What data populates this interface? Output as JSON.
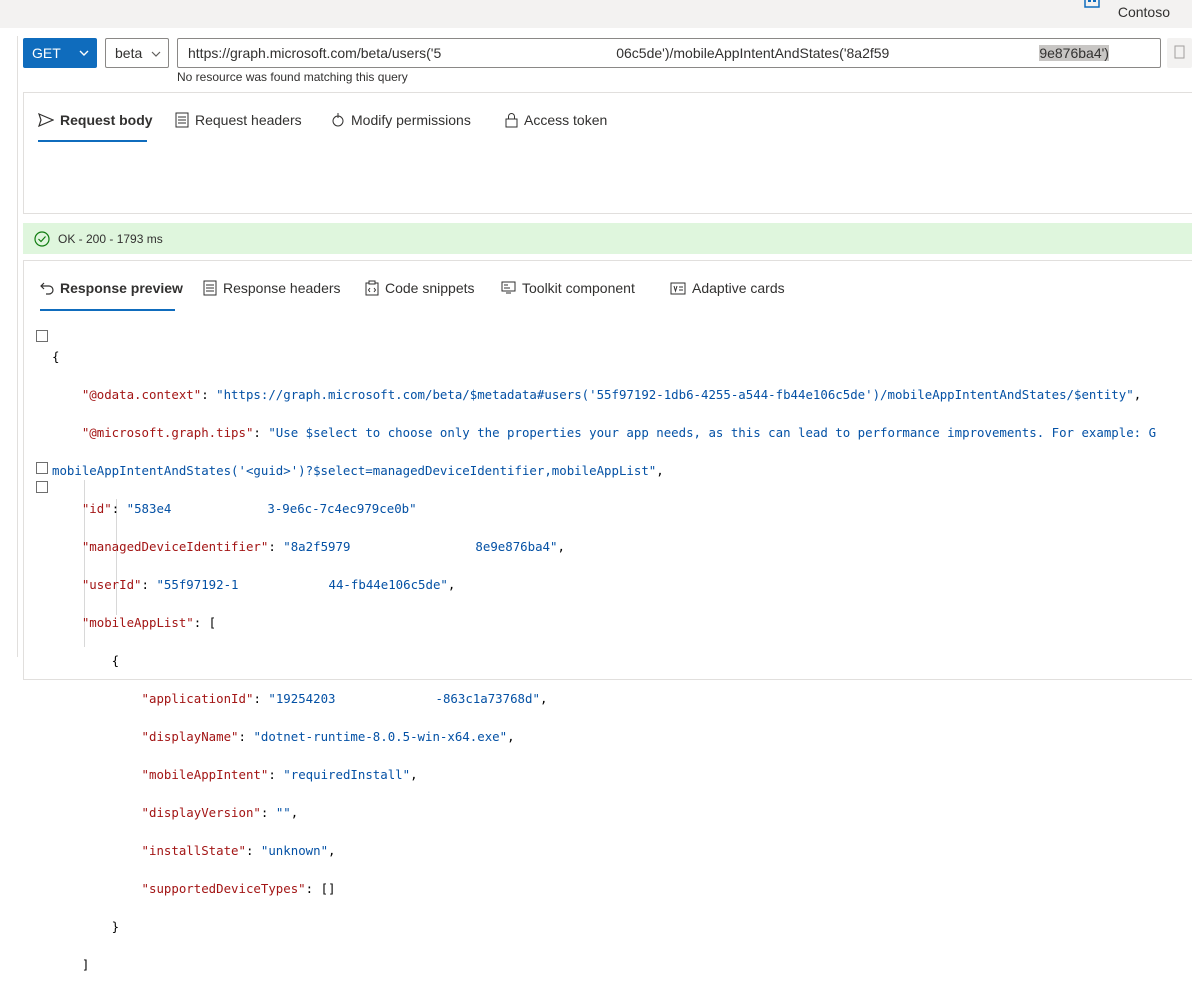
{
  "header": {
    "tenant": "Contoso"
  },
  "query": {
    "method": "GET",
    "version": "beta",
    "url_part1": "https://graph.microsoft.com/beta/users('5",
    "url_part2": "06c5de')/mobileAppIntentAndStates('8a2f59",
    "url_part3": "9e876ba4')",
    "hint": "No resource was found matching this query"
  },
  "request_tabs": [
    {
      "label": "Request body",
      "icon": "send-icon"
    },
    {
      "label": "Request headers",
      "icon": "headers-icon"
    },
    {
      "label": "Modify permissions",
      "icon": "permissions-icon"
    },
    {
      "label": "Access token",
      "icon": "lock-icon"
    }
  ],
  "status": {
    "text": "OK - 200 - 1793 ms",
    "color": "#dff6dd",
    "icon": "check-circle-icon"
  },
  "response_tabs": [
    {
      "label": "Response preview",
      "icon": "undo-icon"
    },
    {
      "label": "Response headers",
      "icon": "headers-icon"
    },
    {
      "label": "Code snippets",
      "icon": "clipboard-icon"
    },
    {
      "label": "Toolkit component",
      "icon": "component-icon"
    },
    {
      "label": "Adaptive cards",
      "icon": "card-icon"
    }
  ],
  "response": {
    "odata_context_key": "\"@odata.context\"",
    "odata_context_val": "\"https://graph.microsoft.com/beta/$metadata#users('55f97192-1db6-4255-a544-fb44e106c5de')/mobileAppIntentAndStates/$entity\"",
    "tips_key": "\"@microsoft.graph.tips\"",
    "tips_val": "\"Use $select to choose only the properties your app needs, as this can lead to performance improvements. For example: G",
    "tips_val_cont": "mobileAppIntentAndStates('<guid>')?$select=managedDeviceIdentifier,mobileAppList\"",
    "id_key": "\"id\"",
    "id_val_a": "\"583e4",
    "id_val_b": "3-9e6c-7c4ec979ce0b\"",
    "mdi_key": "\"managedDeviceIdentifier\"",
    "mdi_val_a": "\"8a2f5979",
    "mdi_val_b": "8e9e876ba4\"",
    "user_key": "\"userId\"",
    "user_val_a": "\"55f97192-1",
    "user_val_b": "44-fb44e106c5de\"",
    "list_key": "\"mobileAppList\"",
    "app": {
      "applicationId_key": "\"applicationId\"",
      "applicationId_val_a": "\"19254203",
      "applicationId_val_b": "-863c1a73768d\"",
      "displayName_key": "\"displayName\"",
      "displayName_val": "\"dotnet-runtime-8.0.5-win-x64.exe\"",
      "intent_key": "\"mobileAppIntent\"",
      "intent_val": "\"requiredInstall\"",
      "version_key": "\"displayVersion\"",
      "version_val": "\"\"",
      "state_key": "\"installState\"",
      "state_val": "\"unknown\"",
      "types_key": "\"supportedDeviceTypes\"",
      "types_val": "[]"
    }
  },
  "colors": {
    "accent": "#0f6cbd",
    "json_key": "#a31515",
    "json_string": "#0451a5"
  }
}
